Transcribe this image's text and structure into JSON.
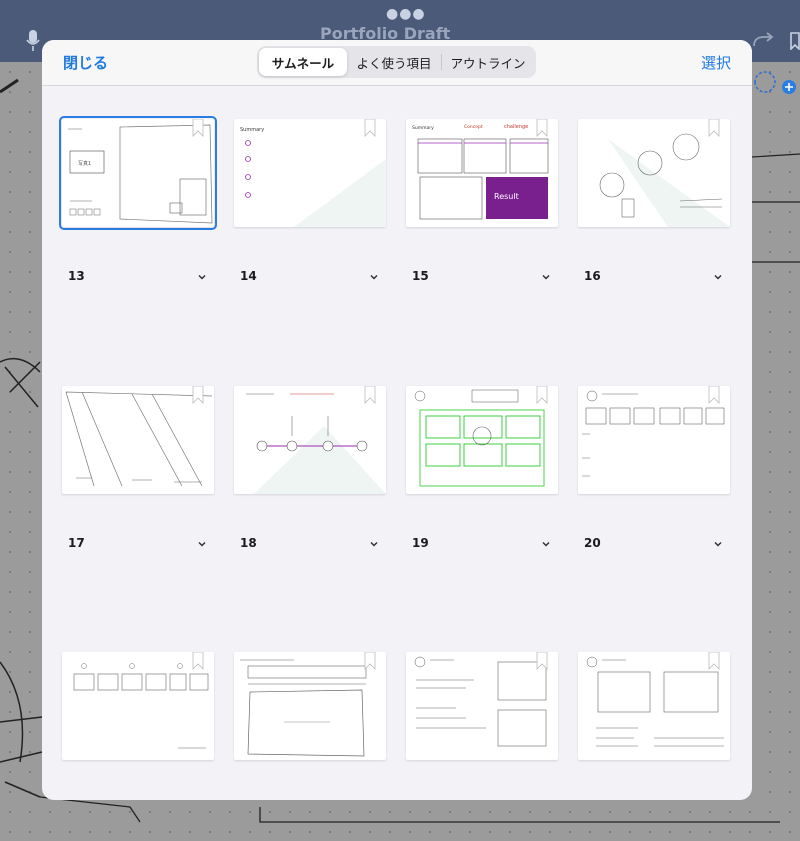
{
  "header": {
    "close_label": "閉じる",
    "select_label": "選択",
    "segments": [
      {
        "label": "サムネール",
        "active": true
      },
      {
        "label": "よく使う項目",
        "active": false
      },
      {
        "label": "アウトライン",
        "active": false
      }
    ]
  },
  "background": {
    "title": "Portfolio Draft"
  },
  "rows": [
    {
      "numbers": [
        "13",
        "14",
        "15",
        "16"
      ]
    },
    {
      "numbers": [
        "17",
        "18",
        "19",
        "20"
      ]
    }
  ],
  "thumbnails": [
    {
      "name": "page-thumb-1",
      "icon": "page-thumbnail",
      "selected": true,
      "color": "#ffffff"
    },
    {
      "name": "page-thumb-2",
      "icon": "page-thumbnail",
      "selected": false
    },
    {
      "name": "page-thumb-3",
      "icon": "page-thumbnail",
      "selected": false
    },
    {
      "name": "page-thumb-4",
      "icon": "page-thumbnail",
      "selected": false
    },
    {
      "name": "page-thumb-13",
      "icon": "page-thumbnail",
      "selected": false
    },
    {
      "name": "page-thumb-14",
      "icon": "page-thumbnail",
      "selected": false
    },
    {
      "name": "page-thumb-15",
      "icon": "page-thumbnail",
      "selected": false
    },
    {
      "name": "page-thumb-16",
      "icon": "page-thumbnail",
      "selected": false
    },
    {
      "name": "page-thumb-17",
      "icon": "page-thumbnail",
      "selected": false
    },
    {
      "name": "page-thumb-18",
      "icon": "page-thumbnail",
      "selected": false
    },
    {
      "name": "page-thumb-19",
      "icon": "page-thumbnail",
      "selected": false
    },
    {
      "name": "page-thumb-20",
      "icon": "page-thumbnail",
      "selected": false
    }
  ],
  "colors": {
    "accent": "#1f7ae0",
    "selection": "#2a7de1",
    "result_purple": "#7a1f8e",
    "green_boxes": "#3ecf3e"
  }
}
